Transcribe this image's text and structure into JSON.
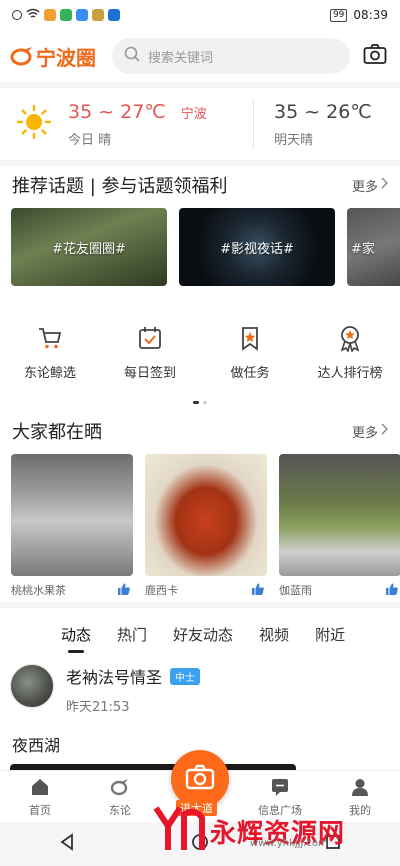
{
  "status": {
    "time": "08:39",
    "battery": "99",
    "icon_colors": [
      "#f0a030",
      "#35b35a",
      "#3a8ef0",
      "#e84545",
      "#f0c000",
      "#1e6fd6"
    ]
  },
  "header": {
    "logo_text": "宁波圈",
    "search_placeholder": "搜索关键词"
  },
  "weather": {
    "today_temp": "35 ~ 27℃",
    "city": "宁波",
    "today_label": "今日 晴",
    "tomorrow_temp": "35 ~ 26℃",
    "tomorrow_label": "明天晴"
  },
  "topics": {
    "title": "推荐话题 | 参与话题领福利",
    "more": "更多",
    "items": [
      {
        "label": "#花友圈圈#"
      },
      {
        "label": "#影视夜话#"
      },
      {
        "label": "#家"
      }
    ]
  },
  "quick_actions": [
    {
      "label": "东论鲸选",
      "icon": "shopping-cart-icon"
    },
    {
      "label": "每日签到",
      "icon": "calendar-check-icon"
    },
    {
      "label": "做任务",
      "icon": "task-bookmark-icon"
    },
    {
      "label": "达人排行榜",
      "icon": "medal-icon"
    }
  ],
  "shares": {
    "title": "大家都在晒",
    "more": "更多",
    "items": [
      {
        "user": "桃桃水果茶"
      },
      {
        "user": "鹿西卡"
      },
      {
        "user": "伽蓝雨"
      },
      {
        "user": ""
      }
    ]
  },
  "feed": {
    "tabs": [
      "动态",
      "热门",
      "好友动态",
      "视频",
      "附近"
    ],
    "active_tab": 0,
    "post": {
      "user": "老衲法号情圣",
      "badge": "中士",
      "time": "昨天21:53",
      "title": "夜西湖"
    }
  },
  "bottom_nav": {
    "items": [
      "首页",
      "东论",
      "进大道",
      "信息广场",
      "我的"
    ],
    "accent": "#ff6a1a"
  },
  "watermark": {
    "text": "永辉资源网",
    "url": "www.yhkjjj.com"
  }
}
